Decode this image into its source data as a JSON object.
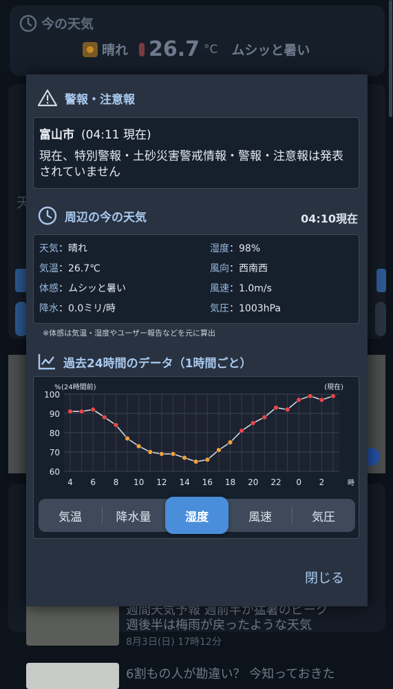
{
  "background": {
    "title": "今の天気",
    "now": {
      "condition": "晴れ",
      "temp": "26.7",
      "unit": "°C",
      "feel": "ムシッと暑い"
    },
    "left_char": "天",
    "news": [
      {
        "title": "週間天気予報 週前半か猛暑のピーク\n週後半は梅雨が戻ったような天気",
        "date": "8月3日(日) 17時12分"
      },
      {
        "title": "6割もの人が勘違い？ 今知っておきた",
        "date": ""
      }
    ]
  },
  "modal": {
    "warning": {
      "title": "警報・注意報",
      "city": "富山市",
      "time": "(04:11 現在)",
      "message": "現在、特別警報・土砂災害警戒情報・警報・注意報は発表されていません"
    },
    "weather": {
      "title": "周辺の今の天気",
      "time": "04:10現在",
      "rows": [
        {
          "key": "天気",
          "sep": "：",
          "value": "晴れ"
        },
        {
          "key": "湿度",
          "sep": "：",
          "value": "98%"
        },
        {
          "key": "気温",
          "sep": "：",
          "value": "26.7℃"
        },
        {
          "key": "風向",
          "sep": "：",
          "value": "西南西"
        },
        {
          "key": "体感",
          "sep": "：",
          "value": "ムシッと暑い"
        },
        {
          "key": "風速",
          "sep": "：",
          "value": "1.0m/s"
        },
        {
          "key": "降水",
          "sep": "：",
          "value": "0.0ミリ/時"
        },
        {
          "key": "気圧",
          "sep": "：",
          "value": "1003hPa"
        }
      ],
      "note": "※体感は気温・湿度やユーザー報告などを元に算出"
    },
    "history": {
      "title": "過去24時間のデータ（1時間ごと）"
    },
    "tabs": [
      {
        "label": "気温",
        "active": false
      },
      {
        "label": "降水量",
        "active": false
      },
      {
        "label": "湿度",
        "active": true
      },
      {
        "label": "風速",
        "active": false
      },
      {
        "label": "気圧",
        "active": false
      }
    ],
    "close_label": "閉じる"
  },
  "chart_data": {
    "type": "line",
    "ylabel": "%",
    "left_note": "(24時間前)",
    "right_note": "(現在)",
    "xunit": "時",
    "ylim": [
      60,
      100
    ],
    "yticks": [
      60,
      70,
      80,
      90,
      100
    ],
    "x": [
      4,
      5,
      6,
      7,
      8,
      9,
      10,
      11,
      12,
      13,
      14,
      15,
      16,
      17,
      18,
      19,
      20,
      21,
      22,
      23,
      0,
      1,
      2,
      3
    ],
    "xticks": [
      "4",
      "6",
      "8",
      "10",
      "12",
      "14",
      "16",
      "18",
      "20",
      "22",
      "0",
      "2"
    ],
    "values": [
      91,
      91,
      92,
      88,
      84,
      77,
      73,
      70,
      69,
      69,
      67,
      65,
      66,
      71,
      75,
      81,
      85,
      88,
      93,
      92,
      97,
      99,
      97,
      99
    ],
    "line_color": "#d4d7dc",
    "marker_low_color": "#f0a23a",
    "marker_high_color": "#e8474a",
    "grid": true
  }
}
